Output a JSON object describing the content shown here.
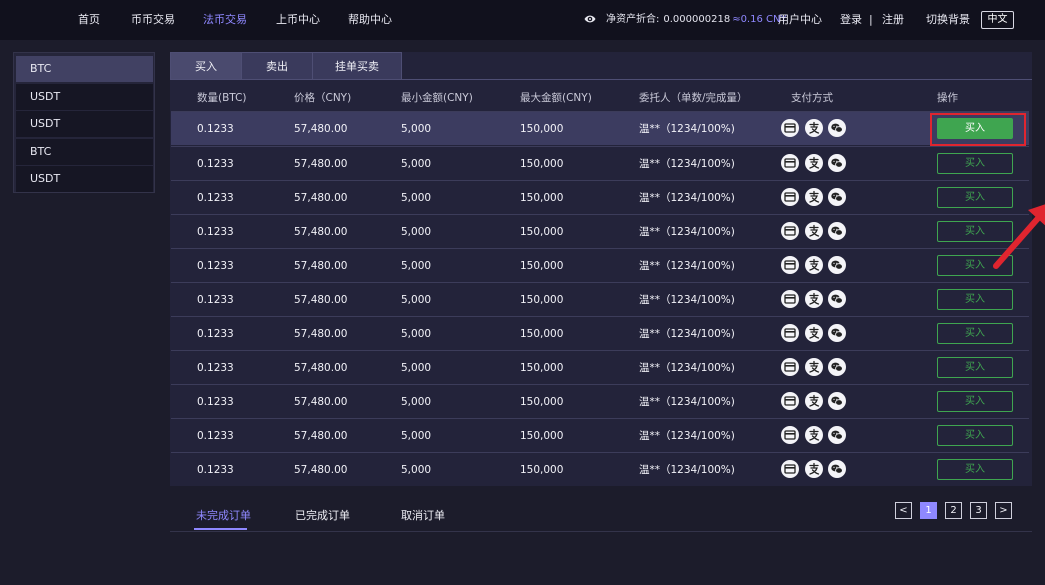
{
  "nav": {
    "items": [
      {
        "label": "首页",
        "active": false
      },
      {
        "label": "币币交易",
        "active": false
      },
      {
        "label": "法币交易",
        "active": true
      },
      {
        "label": "上币中心",
        "active": false
      },
      {
        "label": "帮助中心",
        "active": false
      }
    ],
    "asset_label": "净资产折合:",
    "asset_value": "0.000000218",
    "asset_cny": "≈0.16 CNY",
    "user_center": "用户中心",
    "login": "登录",
    "separator": "|",
    "register": "注册",
    "switch_bg": "切换背景",
    "language": "中文"
  },
  "sidebar": {
    "items": [
      {
        "label": "BTC",
        "active": true
      },
      {
        "label": "USDT",
        "active": false
      },
      {
        "label": "USDT",
        "active": false
      },
      {
        "label": "BTC",
        "active": false
      },
      {
        "label": "USDT",
        "active": false
      }
    ]
  },
  "tabs": [
    {
      "label": "买入",
      "active": true
    },
    {
      "label": "卖出",
      "active": false
    },
    {
      "label": "挂单买卖",
      "active": false
    }
  ],
  "table": {
    "headers": [
      "数量(BTC)",
      "价格（CNY)",
      "最小金额(CNY)",
      "最大金额(CNY)",
      "委托人（单数/完成量）",
      "支付方式",
      "操作"
    ],
    "rows": [
      {
        "qty": "0.1233",
        "price": "57,480.00",
        "min": "5,000",
        "max": "150,000",
        "trader": "温**（1234/100%)",
        "action": "买入"
      },
      {
        "qty": "0.1233",
        "price": "57,480.00",
        "min": "5,000",
        "max": "150,000",
        "trader": "温**（1234/100%)",
        "action": "买入"
      },
      {
        "qty": "0.1233",
        "price": "57,480.00",
        "min": "5,000",
        "max": "150,000",
        "trader": "温**（1234/100%)",
        "action": "买入"
      },
      {
        "qty": "0.1233",
        "price": "57,480.00",
        "min": "5,000",
        "max": "150,000",
        "trader": "温**（1234/100%)",
        "action": "买入"
      },
      {
        "qty": "0.1233",
        "price": "57,480.00",
        "min": "5,000",
        "max": "150,000",
        "trader": "温**（1234/100%)",
        "action": "买入"
      },
      {
        "qty": "0.1233",
        "price": "57,480.00",
        "min": "5,000",
        "max": "150,000",
        "trader": "温**（1234/100%)",
        "action": "买入"
      },
      {
        "qty": "0.1233",
        "price": "57,480.00",
        "min": "5,000",
        "max": "150,000",
        "trader": "温**（1234/100%)",
        "action": "买入"
      },
      {
        "qty": "0.1233",
        "price": "57,480.00",
        "min": "5,000",
        "max": "150,000",
        "trader": "温**（1234/100%)",
        "action": "买入"
      },
      {
        "qty": "0.1233",
        "price": "57,480.00",
        "min": "5,000",
        "max": "150,000",
        "trader": "温**（1234/100%)",
        "action": "买入"
      },
      {
        "qty": "0.1233",
        "price": "57,480.00",
        "min": "5,000",
        "max": "150,000",
        "trader": "温**（1234/100%)",
        "action": "买入"
      },
      {
        "qty": "0.1233",
        "price": "57,480.00",
        "min": "5,000",
        "max": "150,000",
        "trader": "温**（1234/100%)",
        "action": "买入"
      }
    ],
    "payment_icons": [
      "bank-card-icon",
      "alipay-icon",
      "wechat-icon"
    ]
  },
  "order_tabs": [
    {
      "label": "未完成订单",
      "active": true
    },
    {
      "label": "已完成订单",
      "active": false
    },
    {
      "label": "取消订单",
      "active": false
    }
  ],
  "pagination": {
    "prev": "<",
    "pages": [
      "1",
      "2",
      "3"
    ],
    "current": "1",
    "next": ">"
  },
  "colors": {
    "accent": "#8f88ff",
    "buy": "#3fa550",
    "annotation": "#e0252f",
    "background": "#1c1c2b",
    "header": "#11111d"
  }
}
